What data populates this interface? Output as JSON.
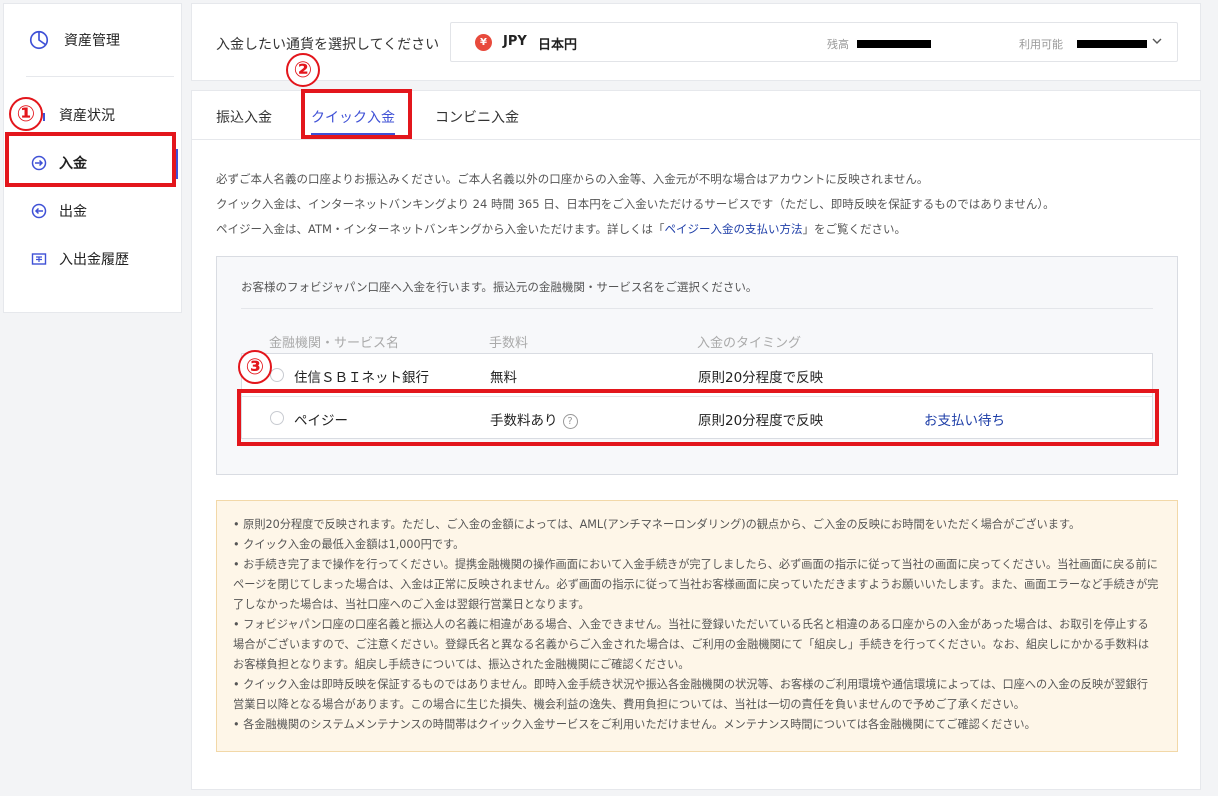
{
  "sidebar": {
    "title": "資産管理",
    "items": [
      {
        "label": "資産状況"
      },
      {
        "label": "入金"
      },
      {
        "label": "出金"
      },
      {
        "label": "入出金履歴"
      }
    ]
  },
  "currency": {
    "prompt": "入金したい通貨を選択してください",
    "symbol": "¥",
    "code": "JPY",
    "name": "日本円",
    "balance_label": "残高",
    "available_label": "利用可能"
  },
  "tabs": [
    "振込入金",
    "クイック入金",
    "コンビニ入金"
  ],
  "notes": {
    "line1": "必ずご本人名義の口座よりお振込みください。ご本人名義以外の口座からの入金等、入金元が不明な場合はアカウントに反映されません。",
    "line2": "クイック入金は、インターネットバンキングより 24 時間 365 日、日本円をご入金いただけるサービスです（ただし、即時反映を保証するものではありません）。",
    "line3_pre": "ペイジー入金は、ATM・インターネットバンキングから入金いただけます。詳しくは「",
    "line3_link": "ペイジー入金の支払い方法",
    "line3_post": "」をご覧ください。"
  },
  "selection": {
    "intro": "お客様のフォビジャパン口座へ入金を行います。振込元の金融機関・サービス名をご選択ください。",
    "headers": [
      "金融機関・サービス名",
      "手数料",
      "入金のタイミング"
    ],
    "options": [
      {
        "name": "住信ＳＢＩネット銀行",
        "fee": "無料",
        "timing": "原則20分程度で反映",
        "action": ""
      },
      {
        "name": "ペイジー",
        "fee": "手数料あり",
        "timing": "原則20分程度で反映",
        "action": "お支払い待ち"
      }
    ]
  },
  "notice": [
    "• 原則20分程度で反映されます。ただし、ご入金の金額によっては、AML(アンチマネーロンダリング)の観点から、ご入金の反映にお時間をいただく場合がございます。",
    "• クイック入金の最低入金額は1,000円です。",
    "• お手続き完了まで操作を行ってください。提携金融機関の操作画面において入金手続きが完了しましたら、必ず画面の指示に従って当社の画面に戻ってください。当社画面に戻る前にページを閉じてしまった場合は、入金は正常に反映されません。必ず画面の指示に従って当社お客様画面に戻っていただきますようお願いいたします。また、画面エラーなど手続きが完了しなかった場合は、当社口座へのご入金は翌銀行営業日となります。",
    "• フォビジャパン口座の口座名義と振込人の名義に相違がある場合、入金できません。当社に登録いただいている氏名と相違のある口座からの入金があった場合は、お取引を停止する場合がございますので、ご注意ください。登録氏名と異なる名義からご入金された場合は、ご利用の金融機関にて「組戻し」手続きを行ってください。なお、組戻しにかかる手数料はお客様負担となります。組戻し手続きについては、振込された金融機関にご確認ください。",
    "• クイック入金は即時反映を保証するものではありません。即時入金手続き状況や振込各金融機関の状況等、お客様のご利用環境や通信環境によっては、口座への入金の反映が翌銀行営業日以降となる場合があります。この場合に生じた損失、機会利益の逸失、費用負担については、当社は一切の責任を負いませんので予めご了承ください。",
    "• 各金融機関のシステムメンテナンスの時間帯はクイック入金サービスをご利用いただけません。メンテナンス時間については各金融機関にてご確認ください。"
  ],
  "annotations": [
    "①",
    "②",
    "③"
  ],
  "colors": {
    "accent": "#3f51d6",
    "annotation": "#e3161c",
    "notice_bg": "#fef6e8",
    "yen_badge": "#e84a3c"
  }
}
